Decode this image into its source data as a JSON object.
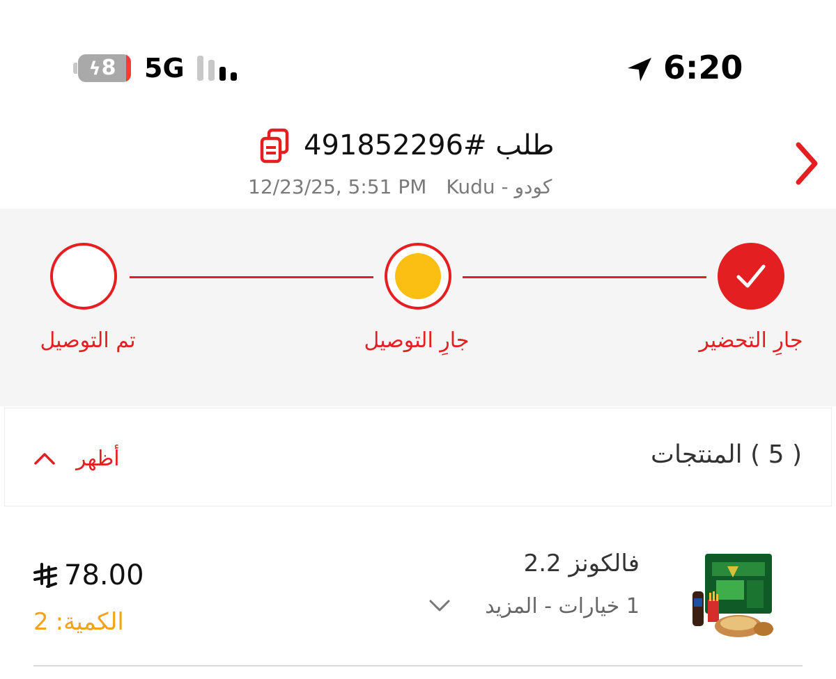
{
  "status_bar": {
    "battery_level": "8",
    "battery_charging": true,
    "network": "5G",
    "signal_bars_active": 2,
    "signal_bars_total": 4,
    "time": "6:20"
  },
  "header": {
    "order_title": "طلب #491852296",
    "store": "كودو - Kudu",
    "datetime": "12/23/25, 5:51 PM",
    "back_icon": "chevron-right-icon",
    "copy_icon": "copy-icon"
  },
  "tracker": {
    "steps": [
      {
        "label": "جارِ التحضير",
        "state": "done"
      },
      {
        "label": "جارِ التوصيل",
        "state": "active"
      },
      {
        "label": "تم التوصيل",
        "state": "pending"
      }
    ]
  },
  "products": {
    "title": "( 5 ) المنتجات",
    "toggle_label": "أظهر",
    "items": [
      {
        "name": "فالكونز 2.2",
        "options": "1 خيارات - المزيد",
        "price": "78.00",
        "quantity_label": ":الكمية",
        "quantity": "2"
      }
    ]
  },
  "colors": {
    "accent": "#e41f22",
    "active_dot": "#fbbf14",
    "quantity": "#f2a31b",
    "tracker_bg": "#f5f5f5"
  }
}
